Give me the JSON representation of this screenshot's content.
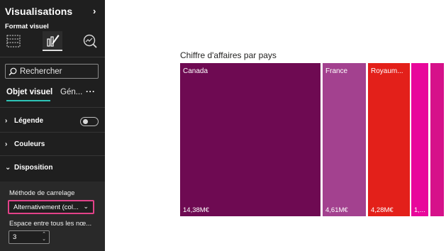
{
  "panel": {
    "title": "Visualisations",
    "format_label": "Format visuel",
    "search_placeholder": "Rechercher",
    "tabs": [
      {
        "label": "Objet visuel",
        "active": true
      },
      {
        "label": "Gén..."
      }
    ],
    "more_label": "···",
    "sections": [
      {
        "label": "Légende",
        "chevron": "›",
        "toggle": "off"
      },
      {
        "label": "Couleurs",
        "chevron": "›"
      },
      {
        "label": "Disposition",
        "chevron": "⌄",
        "expanded": true
      }
    ],
    "tiling_label": "Méthode de carrelage",
    "tiling_value": "Alternativement (col...",
    "spacing_label": "Espace entre tous les nœ...",
    "spacing_value": "3"
  },
  "colors": {
    "panel_bg": "#1f1f1f",
    "accent_teal": "#2ec4b6",
    "highlight_pink": "#e24289"
  },
  "chart_data": {
    "type": "treemap",
    "title": "Chiffre d'affaires par pays",
    "tiles": [
      {
        "label": "Canada",
        "value": 14.38,
        "value_label": "14,38M€",
        "color": "#6e0a52"
      },
      {
        "label": "France",
        "value": 4.61,
        "value_label": "4,61M€",
        "color": "#a3418f"
      },
      {
        "label": "Royaum...",
        "value": 4.28,
        "value_label": "4,28M€",
        "color": "#e3201a"
      },
      {
        "label": "",
        "value": 1.4,
        "value_label": "1,...",
        "color": "#e8089b"
      },
      {
        "label": "",
        "value": 1.2,
        "value_label": "",
        "color": "#d6118a"
      }
    ]
  }
}
